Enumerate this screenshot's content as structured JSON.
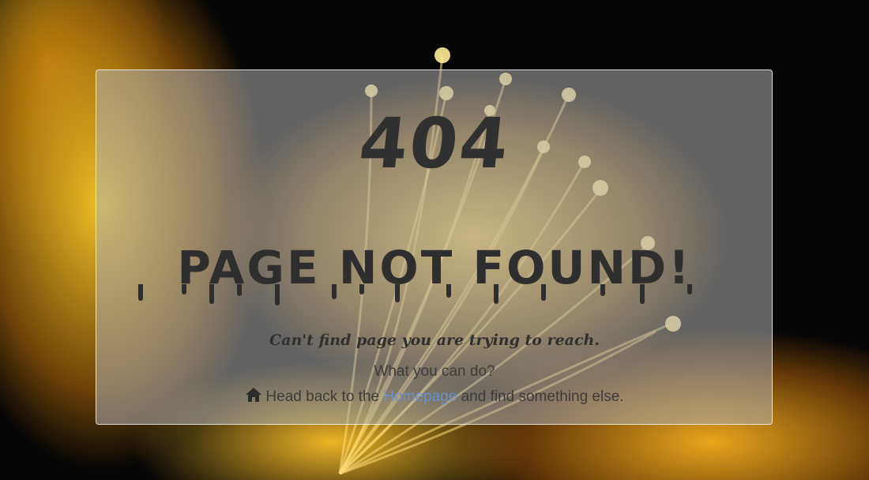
{
  "error": {
    "code": "404",
    "title": "PAGE NOT FOUND!",
    "subtitle": "Can't find page you are trying to reach.",
    "what_label": "What you can do?",
    "head_back_prefix": "Head back to the",
    "homepage_link": "Homepage",
    "head_back_suffix": "and find something else."
  },
  "icons": {
    "home": "home-icon"
  },
  "colors": {
    "card_bg": "#afafaf",
    "text_dark": "#2e2e2e",
    "link": "#6f8fcf",
    "background": "#050505",
    "accent_yellow": "#f5b41e"
  }
}
